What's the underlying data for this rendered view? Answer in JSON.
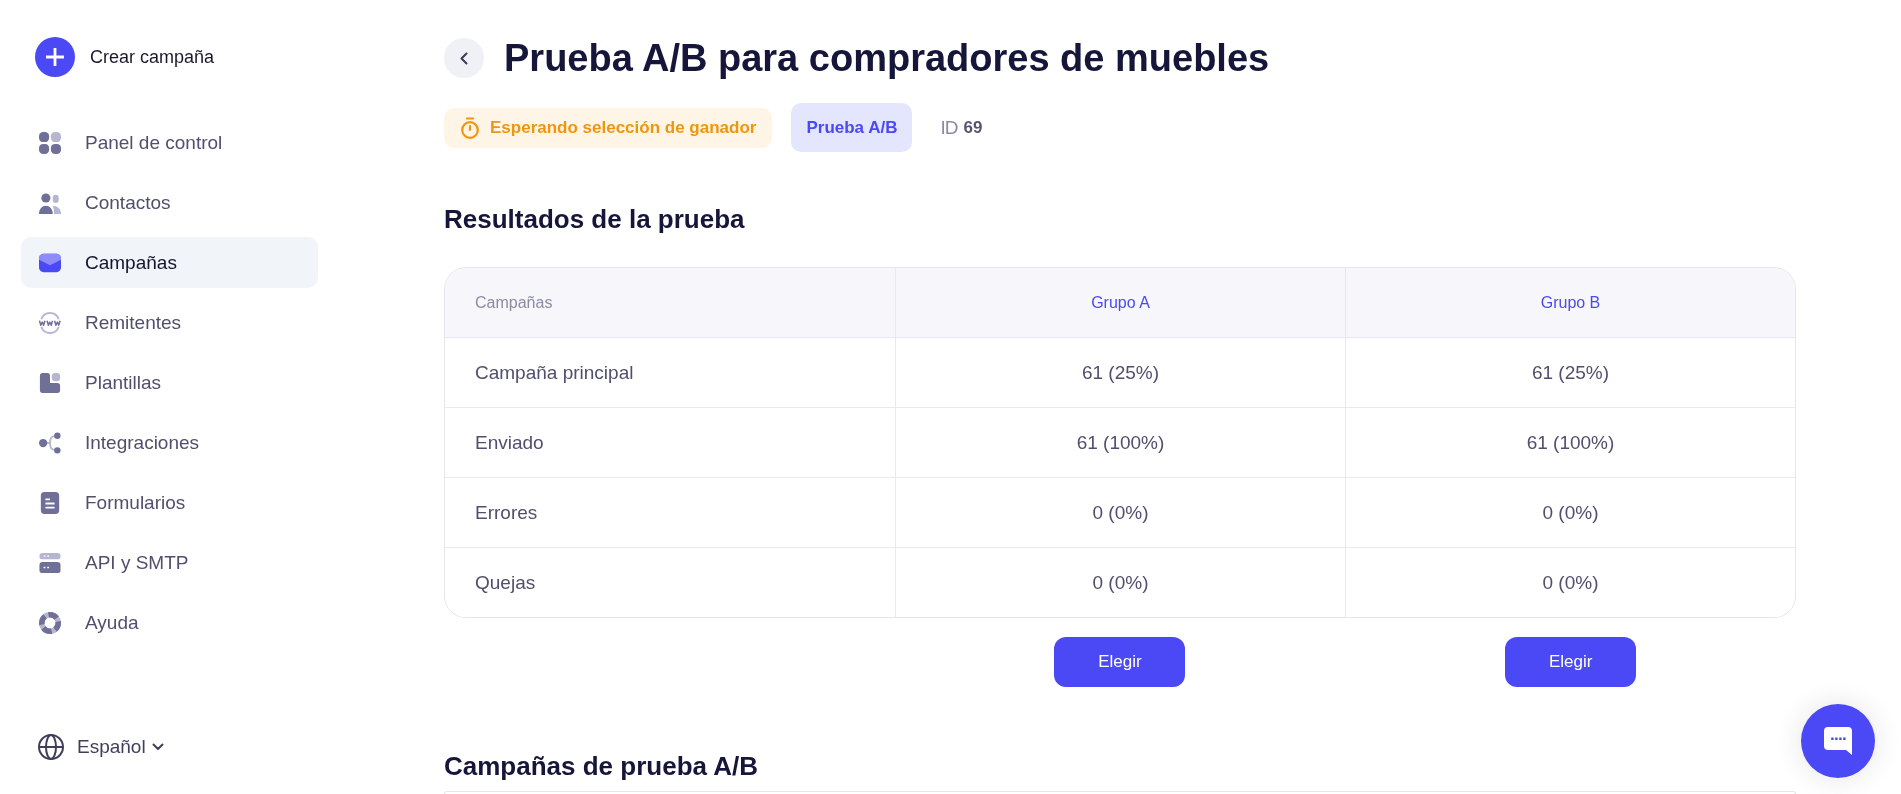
{
  "sidebar": {
    "create_button": "Crear campaña",
    "items": [
      {
        "label": "Panel de control",
        "selected": false
      },
      {
        "label": "Contactos",
        "selected": false
      },
      {
        "label": "Campañas",
        "selected": true
      },
      {
        "label": "Remitentes",
        "selected": false
      },
      {
        "label": "Plantillas",
        "selected": false
      },
      {
        "label": "Integraciones",
        "selected": false
      },
      {
        "label": "Formularios",
        "selected": false
      },
      {
        "label": "API y SMTP",
        "selected": false
      },
      {
        "label": "Ayuda",
        "selected": false
      }
    ],
    "language": "Español"
  },
  "header": {
    "title": "Prueba A/B para compradores de muebles",
    "status": "Esperando selección de ganador",
    "tag": "Prueba A/B",
    "id_label": "ID",
    "id_value": "69"
  },
  "results": {
    "heading": "Resultados de la prueba",
    "table": {
      "columns": [
        "Campañas",
        "Grupo A",
        "Grupo B"
      ],
      "rows": [
        {
          "label": "Campaña principal",
          "values": [
            "61 (25%)",
            "61 (25%)"
          ]
        },
        {
          "label": "Enviado",
          "values": [
            "61 (100%)",
            "61 (100%)"
          ]
        },
        {
          "label": "Errores",
          "values": [
            "0 (0%)",
            "0 (0%)"
          ]
        },
        {
          "label": "Quejas",
          "values": [
            "0 (0%)",
            "0 (0%)"
          ]
        }
      ]
    },
    "choose_buttons": [
      "Elegir",
      "Elegir"
    ]
  },
  "ab_campaigns": {
    "heading": "Campañas de prueba A/B"
  }
}
